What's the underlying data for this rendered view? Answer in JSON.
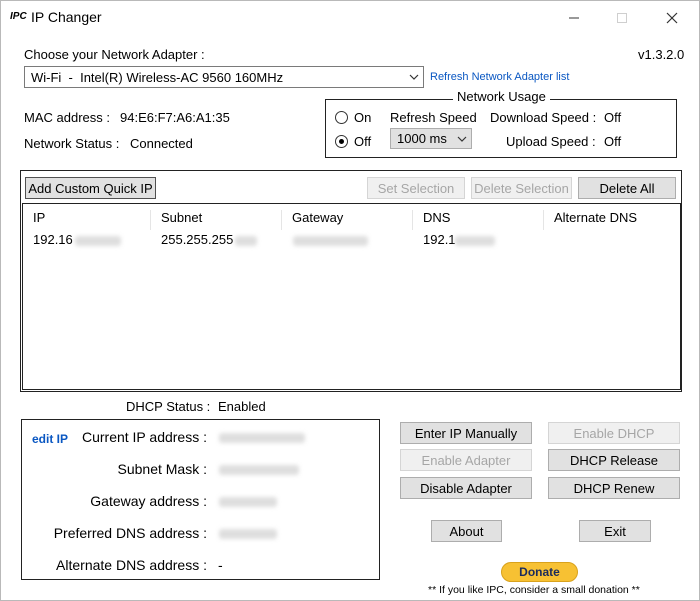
{
  "app": {
    "logo": "IPC",
    "title": "IP Changer",
    "version": "v1.3.2.0"
  },
  "adapter": {
    "label": "Choose your Network Adapter :",
    "selected": "Wi-Fi  -  Intel(R) Wireless-AC 9560 160MHz",
    "refresh_link": "Refresh Network Adapter list"
  },
  "info": {
    "mac_label": "MAC address :",
    "mac_value": "94:E6:F7:A6:A1:35",
    "status_label": "Network Status :",
    "status_value": "Connected"
  },
  "usage": {
    "legend": "Network Usage",
    "on_label": "On",
    "off_label": "Off",
    "refresh_label": "Refresh Speed",
    "speed_value": "1000 ms",
    "download_label": "Download Speed :",
    "download_value": "Off",
    "upload_label": "Upload Speed :",
    "upload_value": "Off"
  },
  "quick": {
    "add_button": "Add Custom Quick IP",
    "set_button": "Set Selection",
    "delete_sel_button": "Delete Selection",
    "delete_all_button": "Delete All",
    "columns": [
      "IP",
      "Subnet",
      "Gateway",
      "DNS",
      "Alternate DNS"
    ],
    "rows": [
      {
        "ip": "192.16",
        "subnet": "255.255.255",
        "gateway": "",
        "dns": "192.1",
        "alt_dns": ""
      }
    ]
  },
  "dhcp": {
    "status_label": "DHCP Status :",
    "status_value": "Enabled"
  },
  "current": {
    "edit_link": "edit IP",
    "ip_label": "Current IP address :",
    "subnet_label": "Subnet Mask :",
    "gateway_label": "Gateway address :",
    "pref_dns_label": "Preferred DNS address :",
    "alt_dns_label": "Alternate DNS address :",
    "alt_dns_value": "-"
  },
  "actions": {
    "enter_manual": "Enter IP Manually",
    "enable_dhcp": "Enable DHCP",
    "enable_adapter": "Enable Adapter",
    "dhcp_release": "DHCP Release",
    "disable_adapter": "Disable Adapter",
    "dhcp_renew": "DHCP Renew",
    "about": "About",
    "exit": "Exit"
  },
  "donate": {
    "button": "Donate",
    "note": "** If you like IPC, consider a small donation **",
    "color": "#f7c133"
  }
}
